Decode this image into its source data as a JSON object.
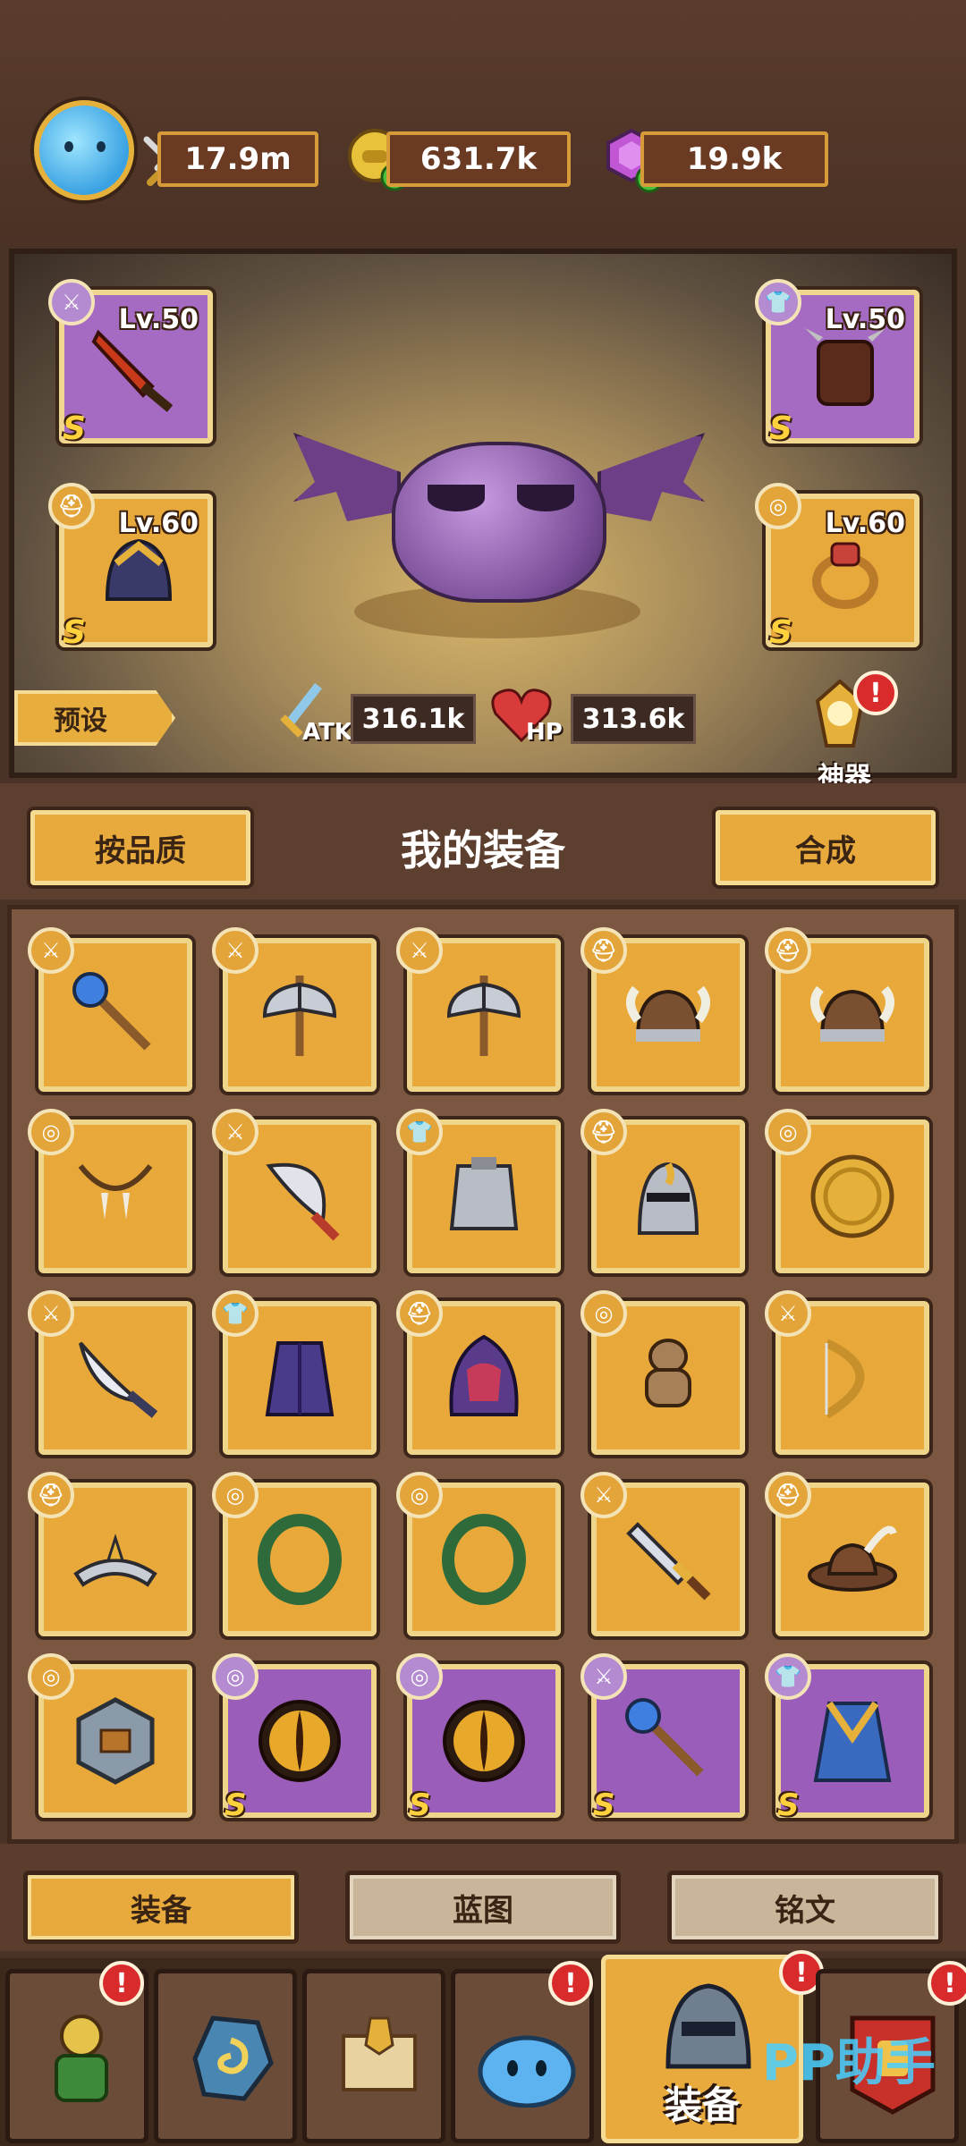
{
  "currencies": {
    "power": "17.9m",
    "gold": "631.7k",
    "gems": "19.9k"
  },
  "equipped": {
    "weapon": {
      "level": "Lv.50",
      "rank": "S"
    },
    "armor": {
      "level": "Lv.50",
      "rank": "S"
    },
    "helmet": {
      "level": "Lv.60",
      "rank": "S"
    },
    "ring": {
      "level": "Lv.60",
      "rank": "S"
    }
  },
  "hero": {
    "preset_label": "预设",
    "atk_label": "ATK",
    "atk_value": "316.1k",
    "hp_label": "HP",
    "hp_value": "313.6k",
    "artifact_label": "神器"
  },
  "header": {
    "sort_button": "按品质",
    "title": "我的装备",
    "merge_button": "合成"
  },
  "grid": {
    "rank_label": "S",
    "items": [
      {
        "type": "weapon",
        "icon": "staff-icon",
        "rarity": "gold"
      },
      {
        "type": "weapon",
        "icon": "battle-axe-icon",
        "rarity": "gold"
      },
      {
        "type": "weapon",
        "icon": "battle-axe-icon",
        "rarity": "gold"
      },
      {
        "type": "helmet",
        "icon": "viking-helmet-icon",
        "rarity": "gold"
      },
      {
        "type": "helmet",
        "icon": "viking-helmet-icon",
        "rarity": "gold"
      },
      {
        "type": "ring",
        "icon": "fang-necklace-icon",
        "rarity": "gold"
      },
      {
        "type": "weapon",
        "icon": "scimitar-icon",
        "rarity": "gold"
      },
      {
        "type": "armor",
        "icon": "chestplate-icon",
        "rarity": "gold"
      },
      {
        "type": "helmet",
        "icon": "knight-helmet-icon",
        "rarity": "gold"
      },
      {
        "type": "ring",
        "icon": "gold-coin-icon",
        "rarity": "gold"
      },
      {
        "type": "weapon",
        "icon": "curved-dagger-icon",
        "rarity": "gold"
      },
      {
        "type": "armor",
        "icon": "purple-coat-icon",
        "rarity": "gold"
      },
      {
        "type": "helmet",
        "icon": "purple-hood-icon",
        "rarity": "gold"
      },
      {
        "type": "ring",
        "icon": "voodoo-doll-icon",
        "rarity": "gold"
      },
      {
        "type": "weapon",
        "icon": "bow-icon",
        "rarity": "gold"
      },
      {
        "type": "helmet",
        "icon": "tiara-icon",
        "rarity": "gold"
      },
      {
        "type": "ring",
        "icon": "jade-ring-icon",
        "rarity": "gold"
      },
      {
        "type": "ring",
        "icon": "jade-ring-icon",
        "rarity": "gold"
      },
      {
        "type": "weapon",
        "icon": "short-sword-icon",
        "rarity": "gold"
      },
      {
        "type": "helmet",
        "icon": "feathered-hat-icon",
        "rarity": "gold"
      },
      {
        "type": "ring",
        "icon": "treasure-stone-icon",
        "rarity": "gold"
      },
      {
        "type": "ring",
        "icon": "dragon-eye-icon",
        "rarity": "purple"
      },
      {
        "type": "ring",
        "icon": "dragon-eye-icon",
        "rarity": "purple"
      },
      {
        "type": "weapon",
        "icon": "staff-icon",
        "rarity": "purple"
      },
      {
        "type": "armor",
        "icon": "royal-coat-icon",
        "rarity": "purple"
      }
    ]
  },
  "tabs": [
    {
      "label": "装备",
      "active": true
    },
    {
      "label": "蓝图",
      "active": false
    },
    {
      "label": "铭文",
      "active": false
    }
  ],
  "nav": {
    "active_label": "装备",
    "items": [
      "hero-icon",
      "rune-icon",
      "scroll-icon",
      "slime-icon",
      "helmet-icon",
      "guild-banner-icon"
    ]
  },
  "watermark": "PP助手",
  "colors": {
    "gold_slot": "#e9a93a",
    "purple_slot": "#9a5db9",
    "alert": "#d92b2b"
  }
}
